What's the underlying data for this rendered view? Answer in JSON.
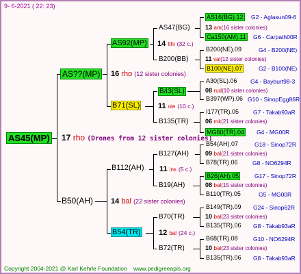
{
  "header": {
    "date": "9- 6-2021 ( 22: 23)"
  },
  "footer": {
    "copyright": "Copyright 2004-2021 @ Karl Kehrle Foundation",
    "site": "www.pedigreeapis.org"
  },
  "colors": {
    "green": "#22dd22",
    "yellow": "#ffee00",
    "cyan": "#00e5ee",
    "lines": "#000000",
    "info": "#0000bb",
    "relation": "#cc0000",
    "sisters": "#800080"
  },
  "queen": {
    "label": "AS45(MP)",
    "count": "17",
    "rel": "rho",
    "sisters": "(Drones from 12 sister colonies)"
  },
  "gen1": {
    "upper": {
      "label": "AS??(MP)",
      "count": "16",
      "rel": "rho",
      "sisters": "(12 sister colonies)"
    },
    "lower": {
      "label": "B50(AH)",
      "count": "14",
      "rel": "bal",
      "sisters": "(22 sister colonies)"
    }
  },
  "gen2": {
    "a": {
      "label": "AS92(MP)",
      "count": "14",
      "rel": "lthl",
      "sisters": "(32 c.)"
    },
    "b": {
      "label": "B71(SL)",
      "count": "11",
      "rel": "oie",
      "sisters": "(10 c.)"
    },
    "c": {
      "label": "B112(AH)",
      "count": "11",
      "rel": "ins",
      "sisters": "(5 c.)"
    },
    "d": {
      "label": "B54(TR)",
      "count": "12",
      "rel": "bal",
      "sisters": "(24 c.)"
    }
  },
  "gen3": {
    "a1": {
      "label": "AS47(BG)",
      "count": "13",
      "rel": "am",
      "sisters": "(16 sister colonies)"
    },
    "a2": {
      "label": "B200(BB)",
      "count": "11",
      "rel": "val",
      "sisters": "(12 sister colonies)"
    },
    "b1": {
      "label": "B43(SL)",
      "count": "08",
      "rel": "rud",
      "sisters": "(10 sister colonies)"
    },
    "b2": {
      "label": "B135(TR)",
      "count": "06",
      "rel": "mk",
      "sisters": "(21 sister colonies)"
    },
    "c1": {
      "label": "B127(AH)",
      "count": "09",
      "rel": "bal",
      "sisters": "(21 sister colonies)"
    },
    "c2": {
      "label": "B19(AH)",
      "count": "08",
      "rel": "bal",
      "sisters": "(15 sister colonies)"
    },
    "d1": {
      "label": "B70(TR)",
      "count": "10",
      "rel": "bal",
      "sisters": "(23 sister colonies)"
    },
    "d2": {
      "label": "B72(TR)",
      "count": "10",
      "rel": "bal",
      "sisters": "(23 sister colonies)"
    }
  },
  "gen4": [
    {
      "label": "AS16(BG).12",
      "info": "G2 - Aglasun09-6"
    },
    {
      "label": "Ca150(AM).11",
      "info": "G6 - Carpath00R"
    },
    {
      "label": "B200(NE).09",
      "info": "G4 - B200(NE)"
    },
    {
      "label": "B100(NE).07",
      "info": "G2 - B100(NE)"
    },
    {
      "label": "A30(SL).06",
      "info": "G4 - Bayburt98-3"
    },
    {
      "label": "B397(WP).06",
      "info": "G10 - SinopEgg86R"
    },
    {
      "label": "I177(TR).05",
      "info": "G7 - Takab93aR"
    },
    {
      "label": "MG60(TR).04",
      "info": "G4 - MG00R"
    },
    {
      "label": "B54(AH).07",
      "info": "G18 - Sinop72R"
    },
    {
      "label": "B78(TR).06",
      "info": "G8 - NO6294R"
    },
    {
      "label": "B26(AH).05",
      "info": "G17 - Sinop72R"
    },
    {
      "label": "B110(TR).05",
      "info": "G5 - MG00R"
    },
    {
      "label": "B149(TR).09",
      "info": "G24 - Sinop62R"
    },
    {
      "label": "B135(TR).06",
      "info": "G8 - Takab93aR"
    },
    {
      "label": "B68(TR).08",
      "info": "G10 - NO6294R"
    },
    {
      "label": "B135(TR).06",
      "info": "G8 - Takab93aR"
    }
  ]
}
